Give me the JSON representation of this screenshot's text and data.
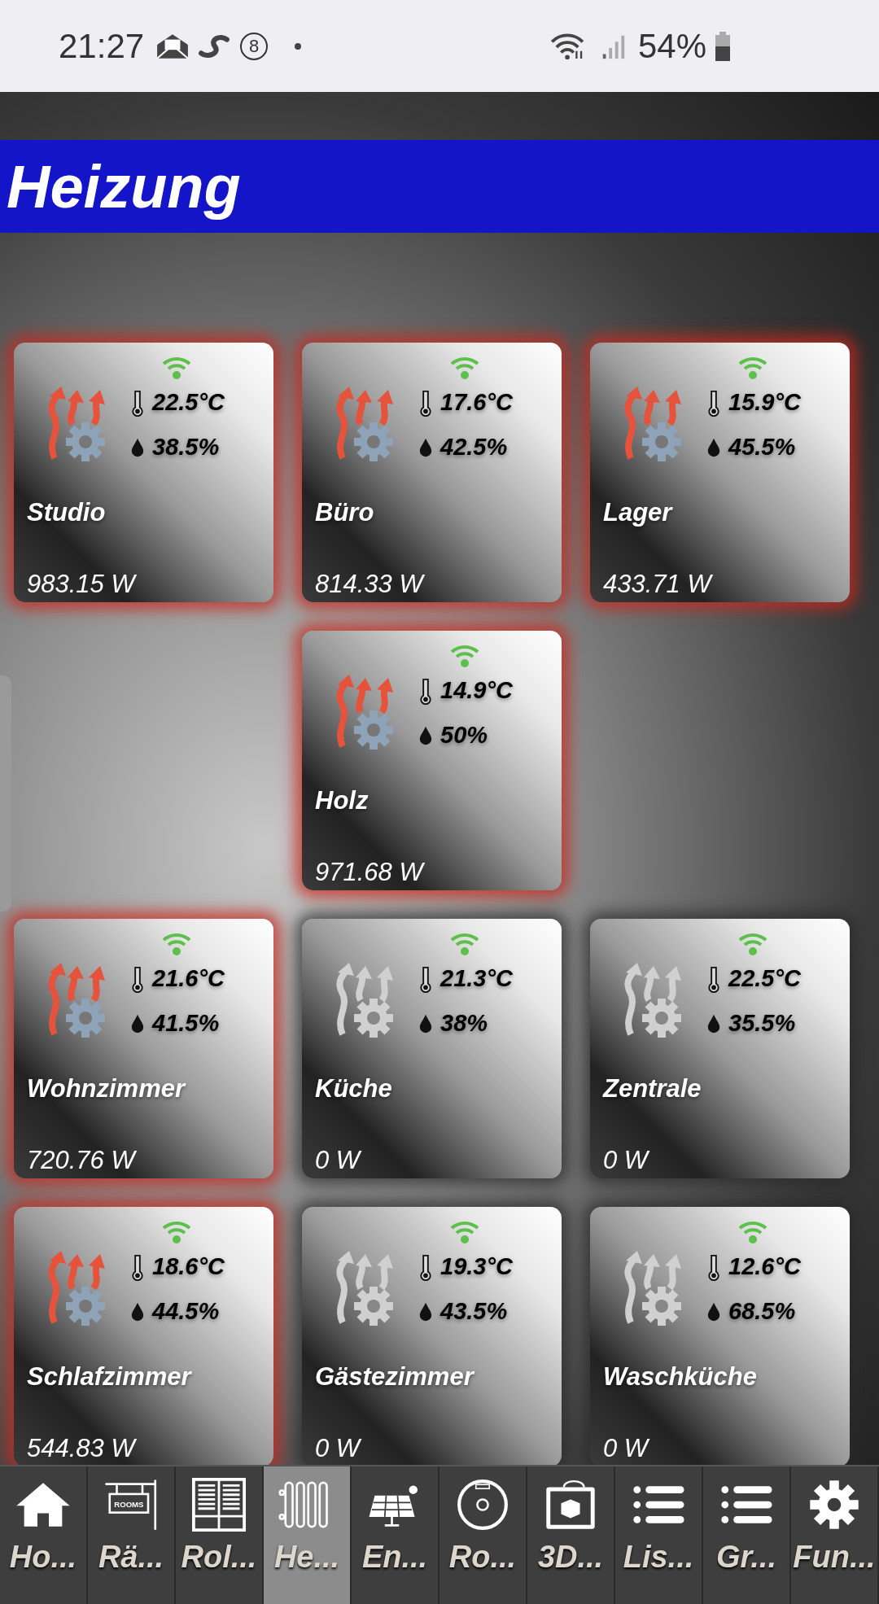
{
  "status_bar": {
    "time": "21:27",
    "badge": "8",
    "battery": "54%"
  },
  "header": {
    "title": "Heizung"
  },
  "rows": [
    {
      "cards": [
        {
          "name": "Studio",
          "temperature": "22.5°C",
          "humidity": "38.5%",
          "power": "983.15 W",
          "heating": true
        },
        {
          "name": "Büro",
          "temperature": "17.6°C",
          "humidity": "42.5%",
          "power": "814.33 W",
          "heating": true
        },
        {
          "name": "Lager",
          "temperature": "15.9°C",
          "humidity": "45.5%",
          "power": "433.71 W",
          "heating": true
        }
      ]
    },
    {
      "cards": [
        {
          "name": "Holz",
          "temperature": "14.9°C",
          "humidity": "50%",
          "power": "971.68 W",
          "heating": true
        }
      ]
    },
    {
      "cards": [
        {
          "name": "Wohnzimmer",
          "temperature": "21.6°C",
          "humidity": "41.5%",
          "power": "720.76 W",
          "heating": true
        },
        {
          "name": "Küche",
          "temperature": "21.3°C",
          "humidity": "38%",
          "power": "0 W",
          "heating": false
        },
        {
          "name": "Zentrale",
          "temperature": "22.5°C",
          "humidity": "35.5%",
          "power": "0 W",
          "heating": false
        }
      ]
    },
    {
      "cards": [
        {
          "name": "Schlafzimmer",
          "temperature": "18.6°C",
          "humidity": "44.5%",
          "power": "544.83 W",
          "heating": true
        },
        {
          "name": "Gästezimmer",
          "temperature": "19.3°C",
          "humidity": "43.5%",
          "power": "0 W",
          "heating": false
        },
        {
          "name": "Waschküche",
          "temperature": "12.6°C",
          "humidity": "68.5%",
          "power": "0 W",
          "heating": false
        }
      ]
    }
  ],
  "nav": [
    {
      "kind": "home",
      "label": "Ho...",
      "selected": false
    },
    {
      "kind": "rooms",
      "label": "Rä...",
      "sign_text": "ROOMS",
      "selected": false
    },
    {
      "kind": "blinds",
      "label": "Rol...",
      "selected": false
    },
    {
      "kind": "radiator",
      "label": "He...",
      "selected": true
    },
    {
      "kind": "solar",
      "label": "En...",
      "selected": false
    },
    {
      "kind": "robot",
      "label": "Ro...",
      "selected": false
    },
    {
      "kind": "printer",
      "label": "3D...",
      "selected": false
    },
    {
      "kind": "list",
      "label": "Lis...",
      "selected": false
    },
    {
      "kind": "list",
      "label": "Gr...",
      "selected": false
    },
    {
      "kind": "gear",
      "label": "Fun...",
      "selected": false
    }
  ]
}
